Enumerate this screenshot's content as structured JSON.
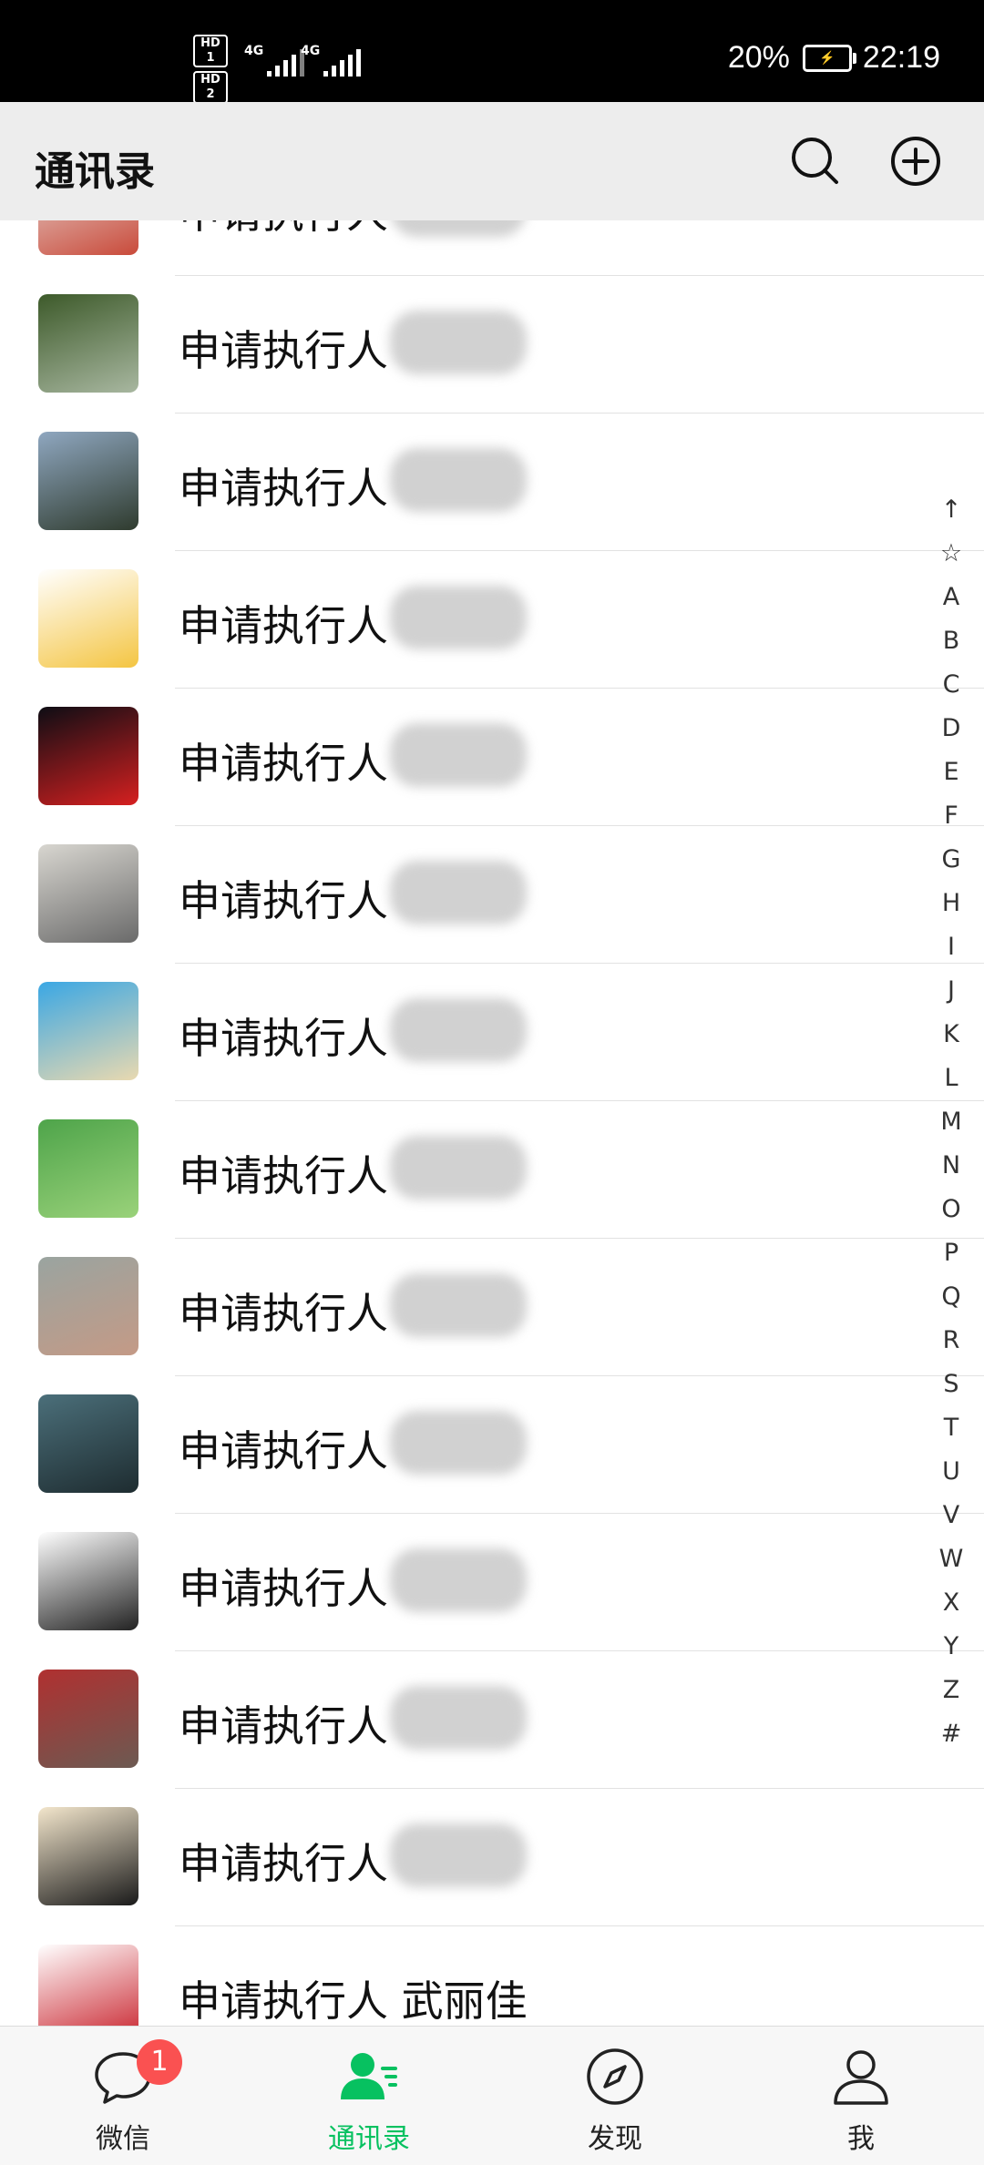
{
  "status_bar": {
    "hd1": "HD 1",
    "hd2": "HD 2",
    "network1": "4G",
    "network2": "4G",
    "battery_percent": "20%",
    "time": "22:19"
  },
  "header": {
    "title": "通讯录",
    "search_icon": "search-icon",
    "add_icon": "plus-circle-icon"
  },
  "contacts": [
    {
      "name": "申请执行人",
      "avatar": "plum-blossom",
      "colors": [
        "#e8e0dc",
        "#c94a3a"
      ]
    },
    {
      "name": "申请执行人",
      "avatar": "waterfall",
      "colors": [
        "#3d5a2a",
        "#a8b7a0"
      ]
    },
    {
      "name": "申请执行人",
      "avatar": "hill-tower",
      "colors": [
        "#8fa7c0",
        "#2f3b2e"
      ]
    },
    {
      "name": "申请执行人",
      "avatar": "psyduck",
      "colors": [
        "#ffffff",
        "#f4c542"
      ]
    },
    {
      "name": "申请执行人",
      "avatar": "mario",
      "colors": [
        "#0d0d14",
        "#d62020"
      ]
    },
    {
      "name": "申请执行人",
      "avatar": "blurred-person",
      "colors": [
        "#d8d6d0",
        "#6a6a6a"
      ]
    },
    {
      "name": "申请执行人",
      "avatar": "beach-palm",
      "colors": [
        "#3aa7e4",
        "#e9d9b0"
      ]
    },
    {
      "name": "申请执行人",
      "avatar": "green-text",
      "colors": [
        "#4ea44a",
        "#9ad27a"
      ]
    },
    {
      "name": "申请执行人",
      "avatar": "blurred-landscape",
      "colors": [
        "#9aa4a0",
        "#c49a86"
      ]
    },
    {
      "name": "申请执行人",
      "avatar": "jumping-man",
      "colors": [
        "#4b6f7a",
        "#1e2c30"
      ]
    },
    {
      "name": "申请执行人",
      "avatar": "anime-boy",
      "colors": [
        "#ffffff",
        "#222222"
      ]
    },
    {
      "name": "申请执行人",
      "avatar": "child-red-chair",
      "colors": [
        "#b03030",
        "#6c5a52"
      ]
    },
    {
      "name": "申请执行人",
      "avatar": "calligraphy",
      "colors": [
        "#f3e6cc",
        "#1a1a1a"
      ]
    },
    {
      "name": "申请执行人 武丽佳",
      "avatar": "bank-logo",
      "colors": [
        "#ffffff",
        "#c8202a"
      ]
    }
  ],
  "index_letters": [
    "↑",
    "☆",
    "A",
    "B",
    "C",
    "D",
    "E",
    "F",
    "G",
    "H",
    "I",
    "J",
    "K",
    "L",
    "M",
    "N",
    "O",
    "P",
    "Q",
    "R",
    "S",
    "T",
    "U",
    "V",
    "W",
    "X",
    "Y",
    "Z",
    "#"
  ],
  "bottom_nav": {
    "items": [
      {
        "label": "微信",
        "icon": "chat-bubble-icon",
        "badge": "1",
        "active": false
      },
      {
        "label": "通讯录",
        "icon": "contacts-icon",
        "active": true
      },
      {
        "label": "发现",
        "icon": "compass-icon",
        "active": false
      },
      {
        "label": "我",
        "icon": "person-icon",
        "active": false
      }
    ]
  },
  "colors": {
    "accent": "#07c160",
    "badge": "#fa5151",
    "header_bg": "#ededed"
  }
}
